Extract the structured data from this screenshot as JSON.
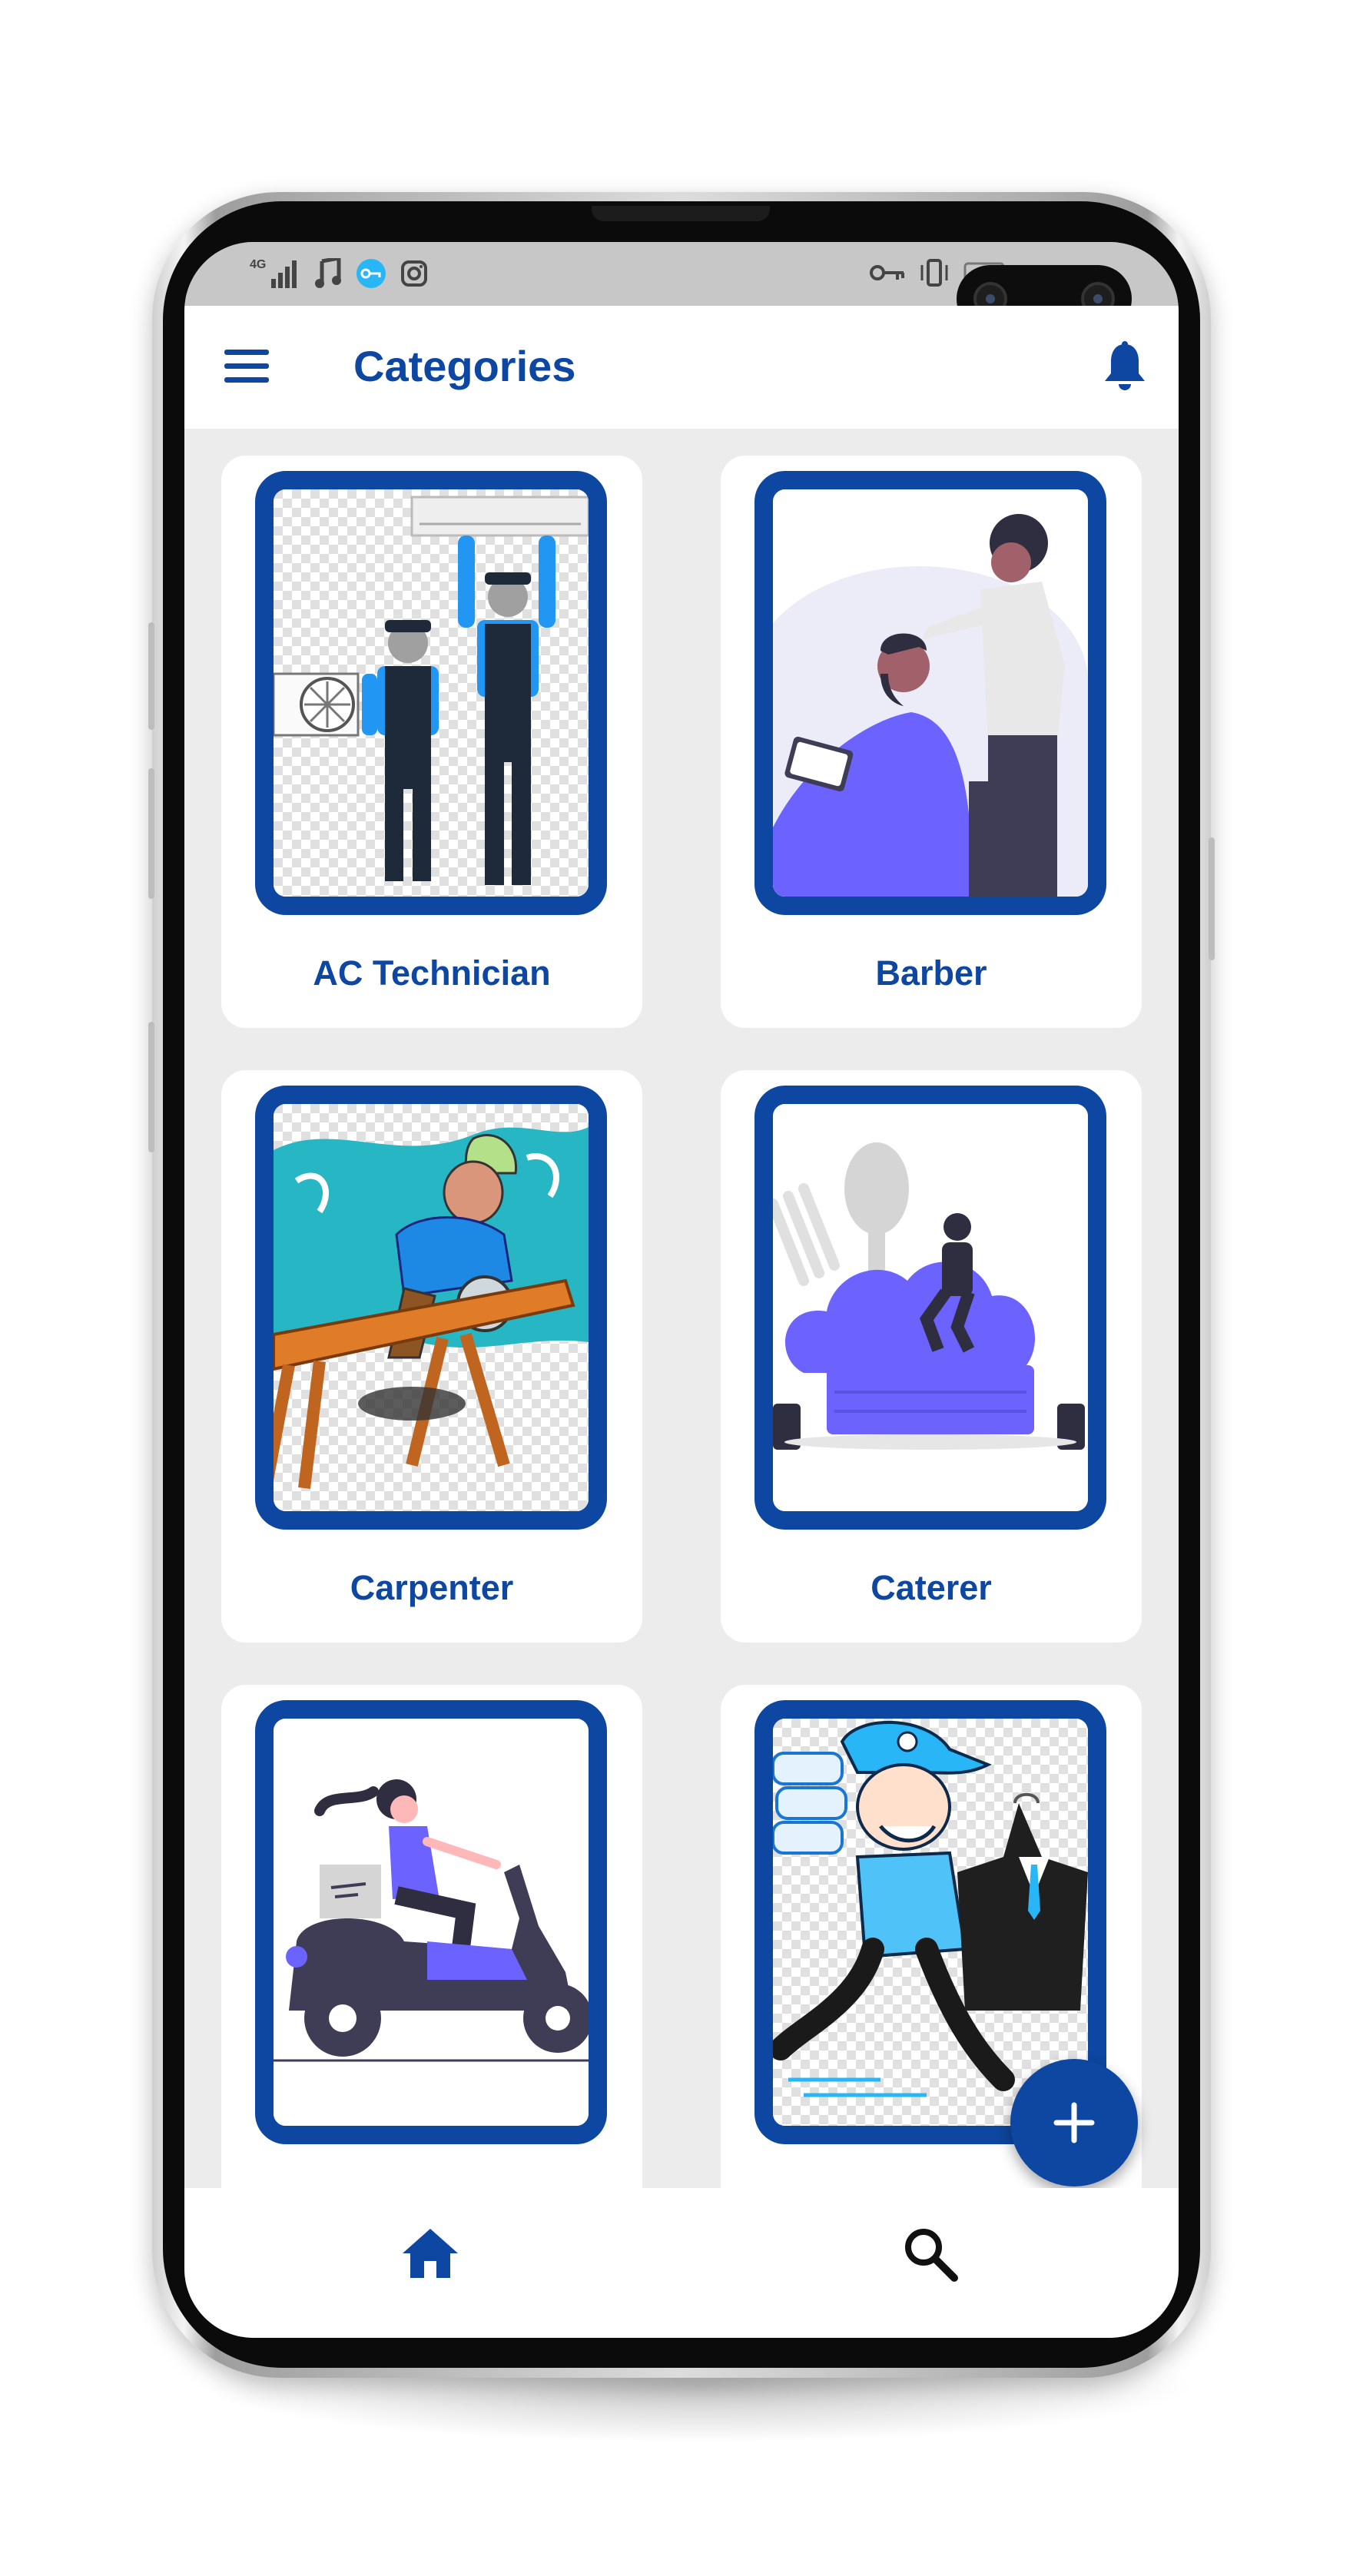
{
  "app_bar": {
    "title": "Categories",
    "menu_icon": "hamburger-menu-icon",
    "notification_icon": "bell-icon"
  },
  "status_bar": {
    "left_icons": [
      "signal-4g-icon",
      "music-icon",
      "vpn-key-icon",
      "instagram-icon"
    ],
    "right_icons": [
      "vpn-key-icon",
      "vibrate-icon",
      "battery-icon"
    ]
  },
  "categories": [
    {
      "label": "AC Technician",
      "icon": "ac-technician-illustration"
    },
    {
      "label": "Barber",
      "icon": "barber-illustration"
    },
    {
      "label": "Carpenter",
      "icon": "carpenter-illustration"
    },
    {
      "label": "Caterer",
      "icon": "caterer-illustration"
    },
    {
      "label": "",
      "icon": "delivery-scooter-illustration"
    },
    {
      "label": "",
      "icon": "dry-cleaner-illustration"
    }
  ],
  "fab": {
    "icon": "plus-icon"
  },
  "bottom_nav": [
    {
      "name": "home",
      "icon": "home-icon",
      "active": true
    },
    {
      "name": "search",
      "icon": "search-icon",
      "active": false
    }
  ],
  "colors": {
    "primary": "#0d47a1",
    "background": "#ececec",
    "card": "#ffffff",
    "status_bar": "#c7c7c7",
    "illustration_purple": "#6c63ff"
  }
}
